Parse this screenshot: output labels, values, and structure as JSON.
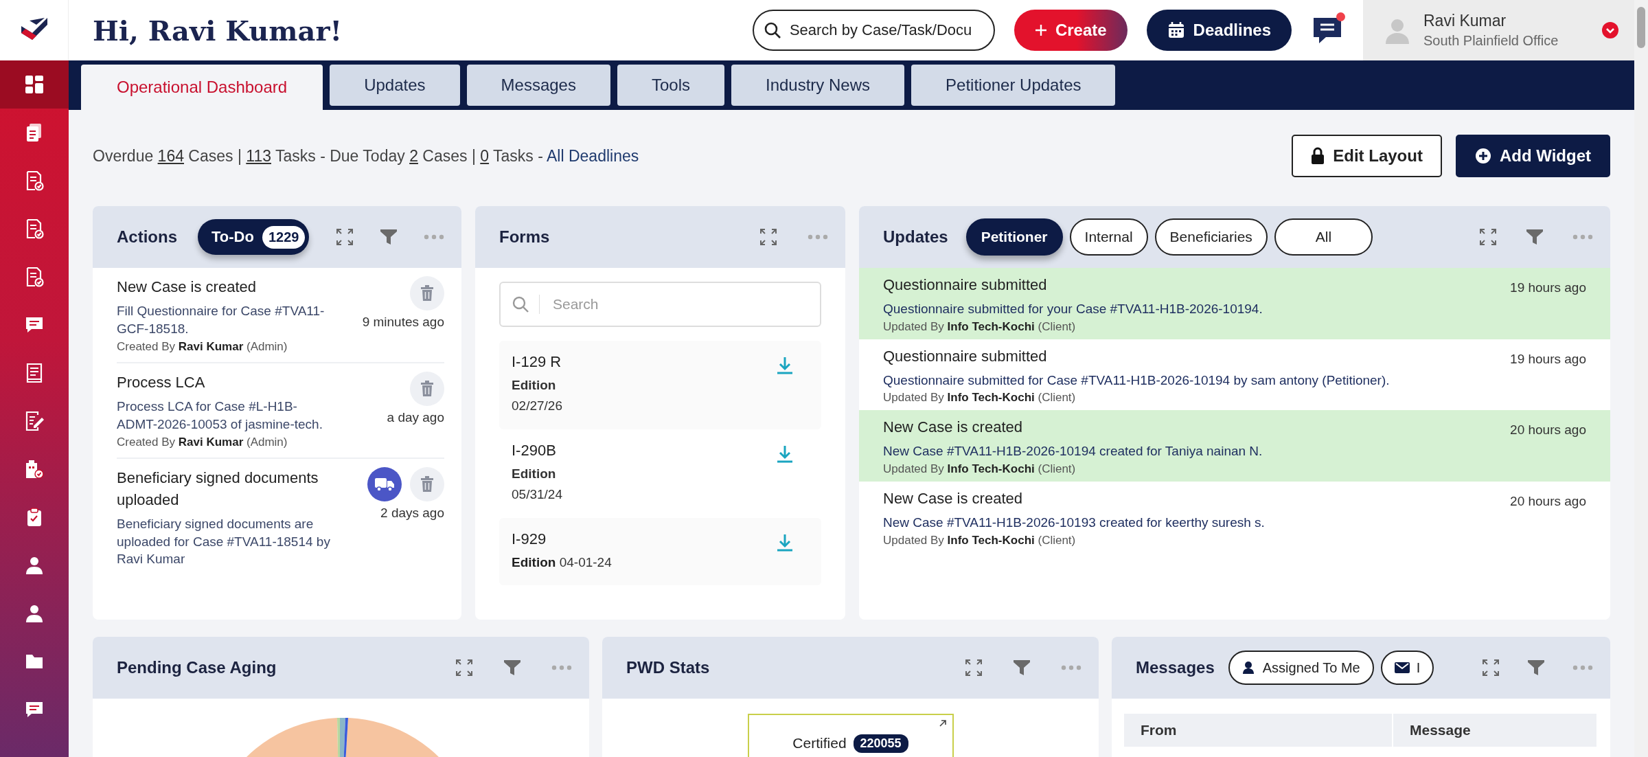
{
  "sidebar": {
    "items": [
      {
        "kind": "grid",
        "selected": true
      },
      {
        "kind": "documents",
        "selected": false
      },
      {
        "kind": "doccheck",
        "selected": false
      },
      {
        "kind": "doccheck",
        "selected": false
      },
      {
        "kind": "doccheck",
        "selected": false
      },
      {
        "kind": "chat",
        "selected": false
      },
      {
        "kind": "book",
        "selected": false
      },
      {
        "kind": "docedit",
        "selected": false
      },
      {
        "kind": "building",
        "selected": false
      },
      {
        "kind": "clipboard",
        "selected": false
      },
      {
        "kind": "user",
        "selected": false
      },
      {
        "kind": "user",
        "selected": false
      },
      {
        "kind": "folder",
        "selected": false
      },
      {
        "kind": "chat",
        "selected": false
      }
    ]
  },
  "header": {
    "greeting": "Hi, Ravi Kumar!",
    "search": {
      "placeholder": "Search by Case/Task/Docu"
    },
    "create_button": "Create",
    "deadlines_button": "Deadlines",
    "chat": {
      "unread": true
    },
    "user": {
      "name": "Ravi Kumar",
      "office": "South Plainfield Office"
    }
  },
  "tabs": [
    {
      "label": "Operational Dashboard",
      "selected": true
    },
    {
      "label": "Updates",
      "selected": false
    },
    {
      "label": "Messages",
      "selected": false
    },
    {
      "label": "Tools",
      "selected": false
    },
    {
      "label": "Industry News",
      "selected": false
    },
    {
      "label": "Petitioner Updates",
      "selected": false
    }
  ],
  "summary": [
    {
      "kind": "text",
      "text": "Overdue "
    },
    {
      "kind": "count",
      "text": "164"
    },
    {
      "kind": "text",
      "text": " Cases | "
    },
    {
      "kind": "count",
      "text": "113"
    },
    {
      "kind": "text",
      "text": " Tasks - Due Today "
    },
    {
      "kind": "count",
      "text": "2"
    },
    {
      "kind": "text",
      "text": " Cases | "
    },
    {
      "kind": "count",
      "text": "0"
    },
    {
      "kind": "text",
      "text": " Tasks - "
    },
    {
      "kind": "link",
      "text": "All Deadlines"
    }
  ],
  "layout_buttons": [
    {
      "kind": "edit",
      "label": "Edit Layout"
    },
    {
      "kind": "add",
      "label": "Add Widget"
    }
  ],
  "actions_widget": {
    "title": "Actions",
    "controls": [
      {
        "kind": "expand"
      },
      {
        "kind": "filter"
      },
      {
        "kind": "more"
      }
    ],
    "filter": {
      "label": "To-Do",
      "count": "1229"
    },
    "items": [
      {
        "title": "New Case is created",
        "description": "Fill Questionnaire for Case #TVA11-GCF-18518.",
        "created_by": "Created By **Ravi Kumar** (Admin)",
        "time": "9 minutes ago",
        "shipment": false
      },
      {
        "title": "Process LCA",
        "description": "Process LCA for Case #L-H1B-ADMT-2026-10053 of jasmine-tech.",
        "created_by": "Created By **Ravi Kumar** (Admin)",
        "time": "a day ago",
        "shipment": false
      },
      {
        "title": "Beneficiary signed documents uploaded",
        "description": "Beneficiary signed documents are uploaded for Case #TVA11-18514 by Ravi Kumar",
        "time": "2 days ago",
        "shipment": true
      }
    ]
  },
  "forms_widget": {
    "title": "Forms",
    "controls": [
      {
        "kind": "expand"
      },
      {
        "kind": "more"
      }
    ],
    "search": {
      "placeholder": "Search"
    },
    "items": [
      {
        "name": "I-129 R",
        "edition_label": "Edition",
        "edition": "02/27/26",
        "kind": "stacked"
      },
      {
        "name": "I-290B",
        "edition_label": "Edition",
        "edition": "05/31/24",
        "kind": "stacked"
      },
      {
        "name": "I-929",
        "edition_label": "Edition",
        "edition": "04-01-24",
        "kind": "inline"
      }
    ]
  },
  "updates_widget": {
    "title": "Updates",
    "controls": [
      {
        "kind": "expand"
      },
      {
        "kind": "filter"
      },
      {
        "kind": "more"
      }
    ],
    "filters": [
      {
        "label": "Petitioner",
        "selected": true
      },
      {
        "label": "Internal",
        "selected": false
      },
      {
        "label": "Beneficiaries",
        "selected": false
      },
      {
        "label": "All",
        "selected": false
      }
    ],
    "items": [
      {
        "title": "Questionnaire submitted",
        "text": "Questionnaire submitted for your Case #TVA11-H1B-2026-10194.",
        "updated_by": "Updated By **Info Tech-Kochi** (Client)",
        "time": "19 hours ago",
        "highlighted": true
      },
      {
        "title": "Questionnaire submitted",
        "text": "Questionnaire submitted for Case #TVA11-H1B-2026-10194 by sam antony (Petitioner).",
        "updated_by": "Updated By **Info Tech-Kochi** (Client)",
        "time": "19 hours ago",
        "highlighted": false
      },
      {
        "title": "New Case is created",
        "text": "New Case #TVA11-H1B-2026-10194 created for Taniya nainan N.",
        "updated_by": "Updated By **Info Tech-Kochi** (Client)",
        "time": "20 hours ago",
        "highlighted": true
      },
      {
        "title": "New Case is created",
        "text": "New Case #TVA11-H1B-2026-10193 created for keerthy suresh s.",
        "updated_by": "Updated By **Info Tech-Kochi** (Client)",
        "time": "20 hours ago",
        "highlighted": false
      }
    ]
  },
  "aging_widget": {
    "title": "Pending Case Aging",
    "controls": [
      {
        "kind": "expand"
      },
      {
        "kind": "filter"
      },
      {
        "kind": "more"
      }
    ]
  },
  "pwd_widget": {
    "title": "PWD Stats",
    "controls": [
      {
        "kind": "expand"
      },
      {
        "kind": "filter"
      },
      {
        "kind": "more"
      }
    ],
    "card": {
      "label": "Certified",
      "count": "220055"
    }
  },
  "messages_widget": {
    "title": "Messages",
    "controls": [
      {
        "kind": "expand"
      },
      {
        "kind": "filter"
      },
      {
        "kind": "more"
      }
    ],
    "filters": [
      {
        "kind": "user",
        "label": "Assigned To Me"
      },
      {
        "kind": "mail",
        "label": "I"
      }
    ],
    "table": {
      "columns": [
        "From",
        "Message"
      ]
    }
  }
}
